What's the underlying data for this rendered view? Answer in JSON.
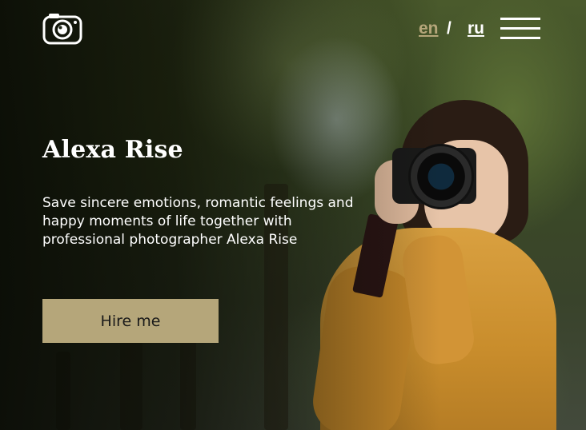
{
  "header": {
    "logo_icon": "camera-icon",
    "languages": {
      "en": "en",
      "separator": "/",
      "ru": "ru",
      "active": "en"
    },
    "menu_icon": "hamburger-menu-icon"
  },
  "hero": {
    "title": "Alexa Rise",
    "subtitle": "Save sincere emotions, romantic feelings and happy moments of life together with professional photographer Alexa Rise",
    "button_label": "Hire me",
    "background_image": "photographer-holding-camera"
  },
  "colors": {
    "accent": "#b5a67a",
    "text": "#ffffff",
    "button_text": "#1a1a1a"
  }
}
